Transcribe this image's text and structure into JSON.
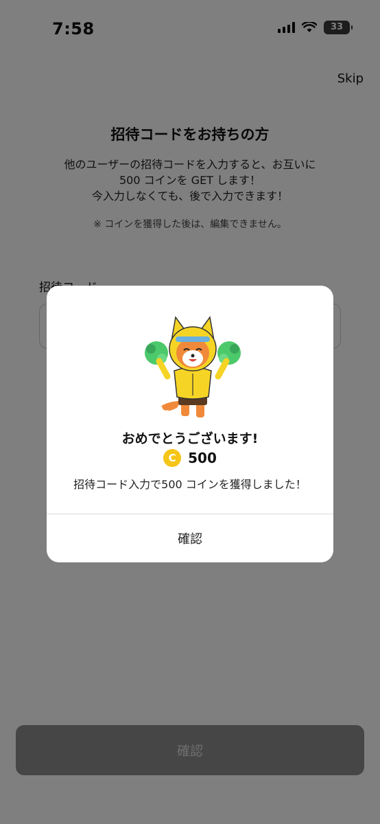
{
  "status_bar": {
    "time": "7:58",
    "battery": "33"
  },
  "header": {
    "skip_label": "Skip"
  },
  "main": {
    "title": "招待コードをお持ちの方",
    "description_line1": "他のユーザーの招待コードを入力すると、お互いに",
    "description_line2": "500 コインを GET します！",
    "description_line3": "今入力しなくても、後で入力できます！",
    "note": "※ コインを獲得した後は、編集できません。",
    "field_label": "招待コード",
    "confirm_label": "確認"
  },
  "modal": {
    "title": "おめでとうございます!",
    "coin_symbol": "C",
    "coin_amount": "500",
    "message": "招待コード入力で500 コインを獲得しました！",
    "confirm_label": "確認"
  },
  "colors": {
    "coin": "#f5c518",
    "overlay": "rgba(0,0,0,0.5)",
    "mascot_hood": "#f5d425"
  }
}
